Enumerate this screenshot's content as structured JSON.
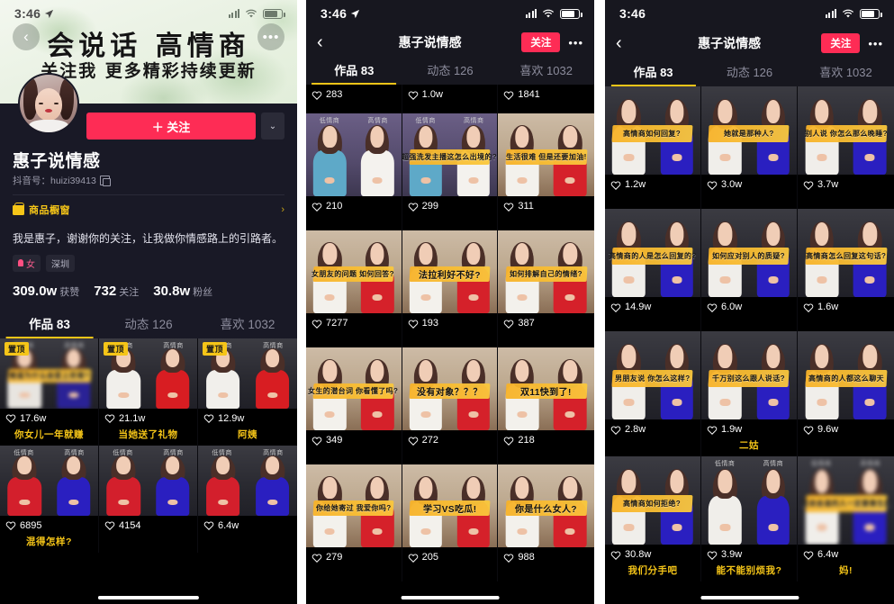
{
  "panel1": {
    "status": {
      "time": "3:46",
      "location_icon": "location-arrow-icon",
      "signal": "signal-bars-icon",
      "wifi": "wifi-icon",
      "battery": "battery-icon"
    },
    "cover": {
      "title": "会说话 高情商",
      "subtitle": "关注我 更多精彩持续更新",
      "back": "‹",
      "more": "•••"
    },
    "profile": {
      "follow_label": "＋ 关注",
      "caret": "⌄",
      "username": "惠子说情感",
      "uid_label": "抖音号：huizi39413",
      "copy_icon": "copy-icon",
      "shop_label": "商品橱窗",
      "shop_arrow": "›",
      "bio": "我是惠子，谢谢你的关注，让我做你情感路上的引路者。",
      "tags": [
        {
          "label": "女",
          "icon": "gender-female-icon"
        },
        {
          "label": "深圳",
          "icon": ""
        }
      ],
      "stats": [
        {
          "value": "309.0w",
          "label": "获赞"
        },
        {
          "value": "732",
          "label": "关注"
        },
        {
          "value": "30.8w",
          "label": "粉丝"
        }
      ]
    },
    "tabs": [
      {
        "label": "作品 83",
        "active": true
      },
      {
        "label": "动态 126",
        "active": false
      },
      {
        "label": "喜欢 1032",
        "active": false
      }
    ],
    "grid": [
      {
        "pin": "置顶",
        "likes": "17.6w",
        "caption": "你女儿一年就赚",
        "banner": "难道为什么会爱上欢哥?",
        "blur": true,
        "scene": "dark-pair",
        "left_color": "#e8e5e0",
        "right_color": "#2a2296",
        "lblL": "低情商",
        "lblR": "高情商"
      },
      {
        "pin": "置顶",
        "likes": "21.1w",
        "caption": "当她送了礼物",
        "banner": "",
        "blur": false,
        "scene": "dark-pair",
        "left_color": "#f1efeb",
        "right_color": "#d81d22",
        "lblL": "低情商",
        "lblR": "高情商"
      },
      {
        "pin": "置顶",
        "likes": "12.9w",
        "caption": "阿姨",
        "banner": "",
        "blur": false,
        "scene": "dark-pair",
        "left_color": "#f1efeb",
        "right_color": "#d81d22",
        "lblL": "低情商",
        "lblR": "高情商"
      },
      {
        "pin": "",
        "likes": "6895",
        "caption": "混得怎样?",
        "banner": "",
        "blur": false,
        "scene": "dark-pair",
        "left_color": "#d31f2c",
        "right_color": "#2a1fc0",
        "lblL": "低情商",
        "lblR": "高情商"
      },
      {
        "pin": "",
        "likes": "4154",
        "caption": "",
        "banner": "",
        "blur": false,
        "scene": "dark-pair",
        "left_color": "#d31f2c",
        "right_color": "#2a1fc0",
        "lblL": "低情商",
        "lblR": "高情商"
      },
      {
        "pin": "",
        "likes": "6.4w",
        "caption": "",
        "banner": "",
        "blur": false,
        "scene": "dark-pair",
        "left_color": "#d31f2c",
        "right_color": "#2a1fc0",
        "lblL": "低情商",
        "lblR": "高情商"
      }
    ]
  },
  "panel2": {
    "status": {
      "time": "3:46",
      "location_icon": "location-arrow-icon"
    },
    "nav": {
      "back": "‹",
      "title": "惠子说情感",
      "follow_label": "关注",
      "more": "•••"
    },
    "tabs": [
      {
        "label": "作品 83",
        "active": true
      },
      {
        "label": "动态 126",
        "active": false
      },
      {
        "label": "喜欢 1032",
        "active": false
      }
    ],
    "top_likes": [
      "283",
      "1.0w",
      "1841"
    ],
    "grid": [
      {
        "likes": "210",
        "banner": "",
        "scene": "purple-pair",
        "left_color": "#5ea9c8",
        "right_color": "#f4f2ee",
        "lblL": "低情商",
        "lblR": "高情商"
      },
      {
        "likes": "299",
        "banner": "超强洗发主播这怎么出境的?",
        "scene": "purple-pair",
        "left_color": "#5ea9c8",
        "right_color": "#f4f2ee",
        "lblL": "低情商",
        "lblR": "高情商"
      },
      {
        "likes": "311",
        "banner": "生活很难 但是还要加油!",
        "scene": "shelf-pair",
        "left_color": "#f3f1ec",
        "right_color": "#d5212a",
        "lblL": "",
        "lblR": ""
      },
      {
        "likes": "7277",
        "banner": "女朋友的问题 如何回答?",
        "scene": "shelf-pair",
        "left_color": "#f3f1ec",
        "right_color": "#d5212a",
        "lblL": "",
        "lblR": ""
      },
      {
        "likes": "193",
        "banner": "法拉利好不好?",
        "banner_wide": true,
        "scene": "shelf-pair",
        "left_color": "#f3f1ec",
        "right_color": "#d5212a",
        "lblL": "",
        "lblR": ""
      },
      {
        "likes": "387",
        "banner": "如何排解自己的情绪?",
        "scene": "shelf-pair",
        "left_color": "#f3f1ec",
        "right_color": "#d5212a",
        "lblL": "",
        "lblR": ""
      },
      {
        "likes": "349",
        "banner": "女生的潜台词 你看懂了吗?",
        "scene": "shelf-pair",
        "left_color": "#f3f1ec",
        "right_color": "#d5212a",
        "lblL": "",
        "lblR": ""
      },
      {
        "likes": "272",
        "banner": "没有对象？？？",
        "banner_wide": true,
        "scene": "shelf-pair",
        "left_color": "#f3f1ec",
        "right_color": "#d5212a",
        "lblL": "",
        "lblR": ""
      },
      {
        "likes": "218",
        "banner": "双11快到了!",
        "banner_wide": true,
        "scene": "shelf-pair",
        "left_color": "#f3f1ec",
        "right_color": "#d5212a",
        "lblL": "",
        "lblR": ""
      },
      {
        "likes": "279",
        "banner": "你给她寄过 我爱你吗?",
        "scene": "shelf-pair",
        "left_color": "#f3f1ec",
        "right_color": "#d5212a",
        "lblL": "",
        "lblR": ""
      },
      {
        "likes": "205",
        "banner": "学习VS吃瓜!",
        "banner_wide": true,
        "scene": "shelf-pair",
        "left_color": "#f3f1ec",
        "right_color": "#d5212a",
        "lblL": "",
        "lblR": ""
      },
      {
        "likes": "988",
        "banner": "你是什么女人?",
        "banner_wide": true,
        "scene": "shelf-pair",
        "left_color": "#f3f1ec",
        "right_color": "#d5212a",
        "lblL": "",
        "lblR": ""
      }
    ]
  },
  "panel3": {
    "status": {
      "time": "3:46"
    },
    "nav": {
      "back": "‹",
      "title": "惠子说情感",
      "follow_label": "关注",
      "more": "•••"
    },
    "tabs": [
      {
        "label": "作品 83",
        "active": true
      },
      {
        "label": "动态 126",
        "active": false
      },
      {
        "label": "喜欢 1032",
        "active": false
      }
    ],
    "grid": [
      {
        "likes": "1.2w",
        "caption": "",
        "banner": "高情商如何回复?",
        "blur": false,
        "left_color": "#f0eeea",
        "right_color": "#2a1fc0",
        "lblL": "",
        "lblR": ""
      },
      {
        "likes": "3.0w",
        "caption": "",
        "banner": "她就是那种人?",
        "blur": false,
        "left_color": "#f0eeea",
        "right_color": "#2a1fc0",
        "lblL": "",
        "lblR": ""
      },
      {
        "likes": "3.7w",
        "caption": "",
        "banner": "别人说 你怎么那么晚睡?",
        "blur": false,
        "left_color": "#f0eeea",
        "right_color": "#2a1fc0",
        "lblL": "",
        "lblR": ""
      },
      {
        "likes": "14.9w",
        "caption": "",
        "banner": "高情商的人是怎么回复的?",
        "blur": false,
        "left_color": "#f0eeea",
        "right_color": "#2a1fc0",
        "lblL": "",
        "lblR": ""
      },
      {
        "likes": "6.0w",
        "caption": "",
        "banner": "如何应对别人的质疑?",
        "blur": false,
        "left_color": "#f0eeea",
        "right_color": "#2a1fc0",
        "lblL": "",
        "lblR": ""
      },
      {
        "likes": "1.6w",
        "caption": "",
        "banner": "高情商怎么回复这句话?",
        "blur": false,
        "left_color": "#f0eeea",
        "right_color": "#2a1fc0",
        "lblL": "",
        "lblR": ""
      },
      {
        "likes": "2.8w",
        "caption": "",
        "banner": "男朋友说 你怎么这样?",
        "blur": false,
        "left_color": "#f0eeea",
        "right_color": "#2a1fc0",
        "lblL": "",
        "lblR": ""
      },
      {
        "likes": "1.9w",
        "caption": "二姑",
        "banner": "千万别这么跟人说话?",
        "blur": false,
        "left_color": "#f0eeea",
        "right_color": "#2a1fc0",
        "lblL": "",
        "lblR": ""
      },
      {
        "likes": "9.6w",
        "caption": "",
        "banner": "高情商的人都这么聊天",
        "blur": false,
        "left_color": "#f0eeea",
        "right_color": "#2a1fc0",
        "lblL": "",
        "lblR": ""
      },
      {
        "likes": "30.8w",
        "caption": "我们分手吧",
        "banner": "高情商如何拒绝?",
        "blur": false,
        "left_color": "#f0eeea",
        "right_color": "#2a1fc0",
        "lblL": "",
        "lblR": ""
      },
      {
        "likes": "3.9w",
        "caption": "能不能别烦我?",
        "banner": "",
        "blur": false,
        "left_color": "#f0eeea",
        "right_color": "#2a1fc0",
        "lblL": "低情商",
        "lblR": "高情商"
      },
      {
        "likes": "6.4w",
        "caption": "妈!",
        "banner": "能说会道的人一定要善生的",
        "blur": true,
        "left_color": "#f0eeea",
        "right_color": "#2a1fc0",
        "lblL": "低情商",
        "lblR": "高情商"
      }
    ]
  },
  "colors": {
    "accent_red": "#fe2c55",
    "accent_yellow": "#f5c518",
    "panel_bg": "#191926",
    "nav_bg": "#17171f"
  }
}
